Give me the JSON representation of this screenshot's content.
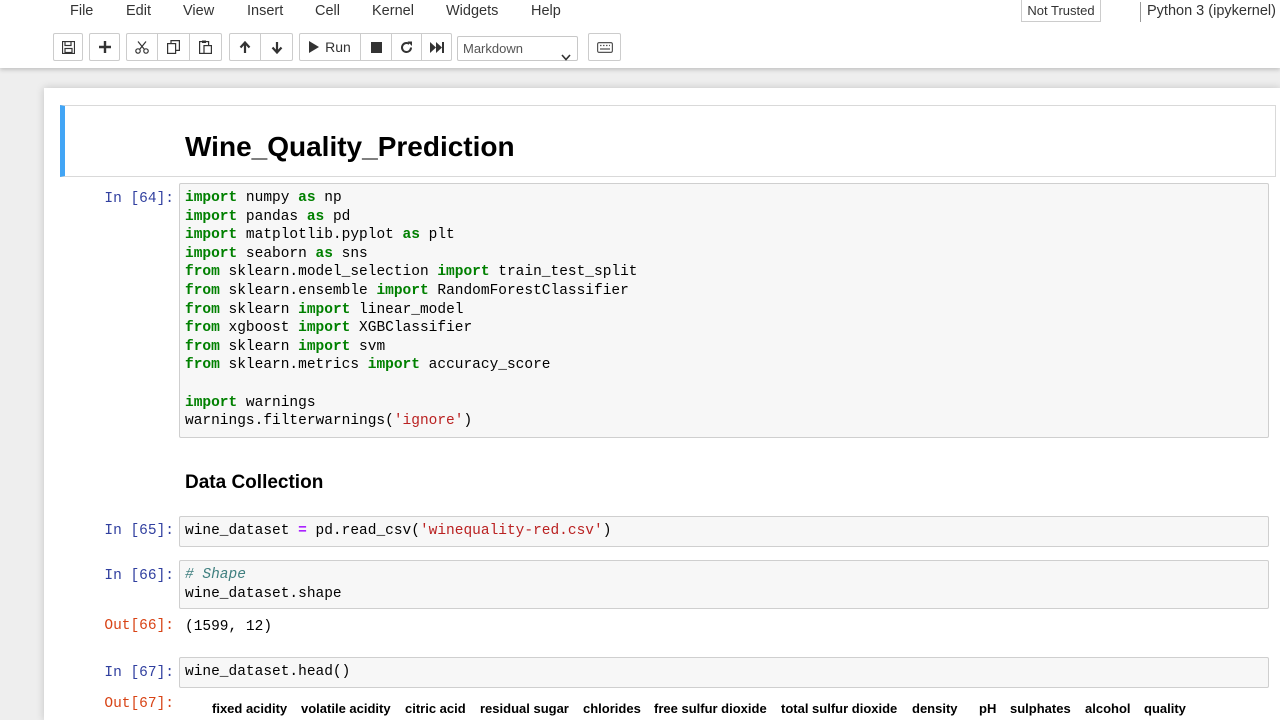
{
  "menubar": {
    "items": [
      "File",
      "Edit",
      "View",
      "Insert",
      "Cell",
      "Kernel",
      "Widgets",
      "Help"
    ],
    "trusted": "Not Trusted",
    "kernel": "Python 3 (ipykernel)"
  },
  "toolbar": {
    "run_label": "Run",
    "cell_type": "Markdown",
    "icons": [
      "save-icon",
      "plus-icon",
      "cut-icon",
      "copy-icon",
      "paste-icon",
      "arrow-up-icon",
      "arrow-down-icon",
      "run-icon",
      "stop-icon",
      "restart-icon",
      "fast-forward-icon",
      "keyboard-icon"
    ]
  },
  "colors": {
    "selected_cell_bar": "#42a5f5",
    "in_prompt": "#303f9f",
    "out_prompt": "#d84315",
    "keyword": "#008000",
    "string": "#ba2121",
    "comment": "#408080"
  },
  "notebook": {
    "title": "Wine_Quality_Prediction",
    "cells": [
      {
        "prompt": "In [64]:",
        "lines": [
          [
            {
              "t": "import",
              "c": "kw"
            },
            {
              "t": " numpy "
            },
            {
              "t": "as",
              "c": "kw"
            },
            {
              "t": " np"
            }
          ],
          [
            {
              "t": "import",
              "c": "kw"
            },
            {
              "t": " pandas "
            },
            {
              "t": "as",
              "c": "kw"
            },
            {
              "t": " pd"
            }
          ],
          [
            {
              "t": "import",
              "c": "kw"
            },
            {
              "t": " matplotlib.pyplot "
            },
            {
              "t": "as",
              "c": "kw"
            },
            {
              "t": " plt"
            }
          ],
          [
            {
              "t": "import",
              "c": "kw"
            },
            {
              "t": " seaborn "
            },
            {
              "t": "as",
              "c": "kw"
            },
            {
              "t": " sns"
            }
          ],
          [
            {
              "t": "from",
              "c": "kw"
            },
            {
              "t": " sklearn.model_selection "
            },
            {
              "t": "import",
              "c": "kw"
            },
            {
              "t": " train_test_split"
            }
          ],
          [
            {
              "t": "from",
              "c": "kw"
            },
            {
              "t": " sklearn.ensemble "
            },
            {
              "t": "import",
              "c": "kw"
            },
            {
              "t": " RandomForestClassifier"
            }
          ],
          [
            {
              "t": "from",
              "c": "kw"
            },
            {
              "t": " sklearn "
            },
            {
              "t": "import",
              "c": "kw"
            },
            {
              "t": " linear_model"
            }
          ],
          [
            {
              "t": "from",
              "c": "kw"
            },
            {
              "t": " xgboost "
            },
            {
              "t": "import",
              "c": "kw"
            },
            {
              "t": " XGBClassifier"
            }
          ],
          [
            {
              "t": "from",
              "c": "kw"
            },
            {
              "t": " sklearn "
            },
            {
              "t": "import",
              "c": "kw"
            },
            {
              "t": " svm"
            }
          ],
          [
            {
              "t": "from",
              "c": "kw"
            },
            {
              "t": " sklearn.metrics "
            },
            {
              "t": "import",
              "c": "kw"
            },
            {
              "t": " accuracy_score"
            }
          ],
          [],
          [
            {
              "t": "import",
              "c": "kw"
            },
            {
              "t": " warnings"
            }
          ],
          [
            {
              "t": "warnings.filterwarnings("
            },
            {
              "t": "'ignore'",
              "c": "str"
            },
            {
              "t": ")"
            }
          ]
        ]
      },
      {
        "prompt": "In [65]:",
        "lines": [
          [
            {
              "t": "wine_dataset "
            },
            {
              "t": "=",
              "c": "op"
            },
            {
              "t": " pd.read_csv("
            },
            {
              "t": "'winequality-red.csv'",
              "c": "str"
            },
            {
              "t": ")"
            }
          ]
        ]
      },
      {
        "prompt": "In [66]:",
        "lines": [
          [
            {
              "t": "# Shape",
              "c": "cmt"
            }
          ],
          [
            {
              "t": "wine_dataset.shape"
            }
          ]
        ],
        "out_prompt": "Out[66]:",
        "output": "(1599, 12)"
      },
      {
        "prompt": "In [67]:",
        "lines": [
          [
            {
              "t": "wine_dataset.head()"
            }
          ]
        ],
        "out_prompt": "Out[67]:"
      }
    ],
    "data_collection_heading": "Data Collection",
    "dataframe_columns": [
      "fixed acidity",
      "volatile acidity",
      "citric acid",
      "residual sugar",
      "chlorides",
      "free sulfur dioxide",
      "total sulfur dioxide",
      "density",
      "pH",
      "sulphates",
      "alcohol",
      "quality"
    ]
  }
}
